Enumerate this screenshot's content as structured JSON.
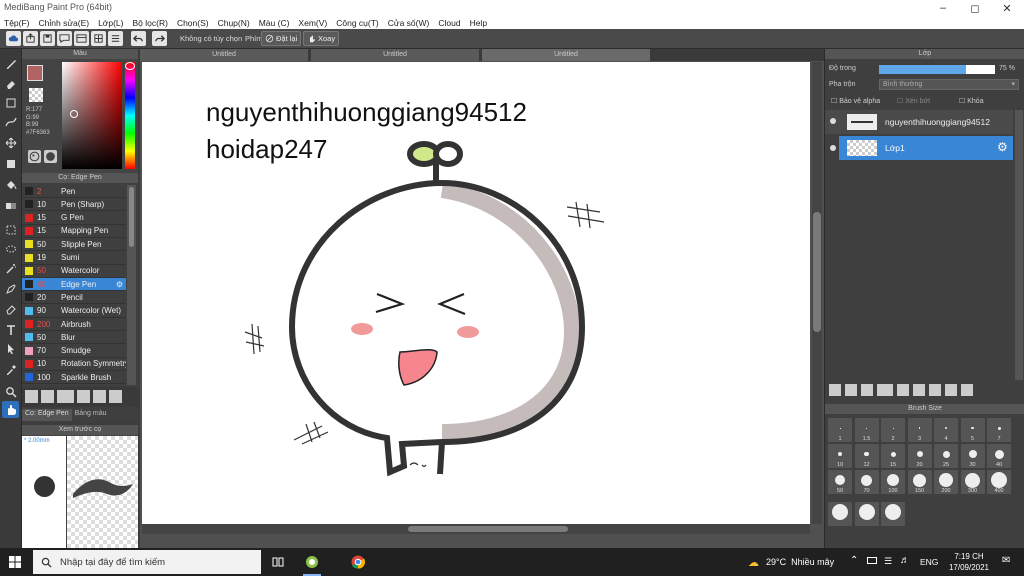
{
  "window": {
    "title": "MediBang Paint Pro (64bit)"
  },
  "menu": [
    "Tệp(F)",
    "Chỉnh sửa(E)",
    "Lớp(L)",
    "Bộ lọc(R)",
    "Chọn(S)",
    "Chụp(N)",
    "Màu (C)",
    "Xem(V)",
    "Công cụ(T)",
    "Cửa số(W)",
    "Cloud",
    "Help"
  ],
  "toolbar": {
    "custom_select": "Không có tùy chọn",
    "keys_label": "Phím",
    "reset_label": "Đặt lại",
    "rotate_label": "Xoay"
  },
  "tabs": [
    "Untitled",
    "Untitled",
    "Untitled"
  ],
  "color_panel": {
    "title": "Màu",
    "r": "R:177",
    "g": "G:99",
    "b": "B:99",
    "hex": "#7F6363",
    "current_color": "#b16363"
  },
  "brush_panel": {
    "title": "Cọ: Edge Pen",
    "items": [
      {
        "size": "2",
        "name": "Pen",
        "color": "#222222",
        "size_color": "#e05050"
      },
      {
        "size": "10",
        "name": "Pen (Sharp)",
        "color": "#222222",
        "size_color": "#eeeeee"
      },
      {
        "size": "15",
        "name": "G Pen",
        "color": "#dd2222",
        "size_color": "#eeeeee"
      },
      {
        "size": "15",
        "name": "Mapping Pen",
        "color": "#dd2222",
        "size_color": "#eeeeee"
      },
      {
        "size": "50",
        "name": "Slipple Pen",
        "color": "#e8e020",
        "size_color": "#eeeeee"
      },
      {
        "size": "19",
        "name": "Sumi",
        "color": "#e8e020",
        "size_color": "#eeeeee"
      },
      {
        "size": "50",
        "name": "Watercolor",
        "color": "#e8e020",
        "size_color": "#e05050"
      },
      {
        "size": "40",
        "name": "Edge Pen",
        "color": "#222222",
        "size_color": "#e05050"
      },
      {
        "size": "20",
        "name": "Pencil",
        "color": "#222222",
        "size_color": "#eeeeee"
      },
      {
        "size": "90",
        "name": "Watercolor (Wet)",
        "color": "#55bbee",
        "size_color": "#eeeeee"
      },
      {
        "size": "200",
        "name": "Airbrush",
        "color": "#dd2222",
        "size_color": "#e05050"
      },
      {
        "size": "50",
        "name": "Blur",
        "color": "#55bbee",
        "size_color": "#eeeeee"
      },
      {
        "size": "70",
        "name": "Smudge",
        "color": "#f0a0c0",
        "size_color": "#eeeeee"
      },
      {
        "size": "10",
        "name": "Rotation Symmetry",
        "color": "#dd2222",
        "size_color": "#eeeeee"
      },
      {
        "size": "100",
        "name": "Sparkle Brush",
        "color": "#2266dd",
        "size_color": "#eeeeee"
      }
    ],
    "tab_brush": "Cọ: Edge Pen",
    "tab_palette": "Bảng màu"
  },
  "preview_panel": {
    "title": "Xem trước cọ",
    "size": "* 2.00mm"
  },
  "canvas": {
    "line1": "nguyenthihuonggiang94512",
    "line2": "hoidap247"
  },
  "layer_panel": {
    "title": "Lớp",
    "opacity_label": "Độ trong",
    "opacity": "75 %",
    "opacity_value": 0.75,
    "blend_label": "Pha trộn",
    "blend_value": "Bình thường",
    "protect_alpha": "Bảo vệ alpha",
    "clipping": "Xén bớt",
    "lock": "Khóa",
    "layers": [
      "nguyenthihuonggiang94512",
      "Lớp1"
    ]
  },
  "brush_size_panel": {
    "title": "Brush Size",
    "sizes": [
      "1",
      "1.5",
      "2",
      "3",
      "4",
      "5",
      "7",
      "10",
      "12",
      "15",
      "20",
      "25",
      "30",
      "40",
      "50",
      "70",
      "100",
      "150",
      "200",
      "300",
      "400"
    ]
  },
  "taskbar": {
    "search_placeholder": "Nhập tại đây để tìm kiếm",
    "weather": "29°C  Nhiều mây",
    "lang": "ENG",
    "time": "7:19 CH",
    "date": "17/09/2021"
  }
}
